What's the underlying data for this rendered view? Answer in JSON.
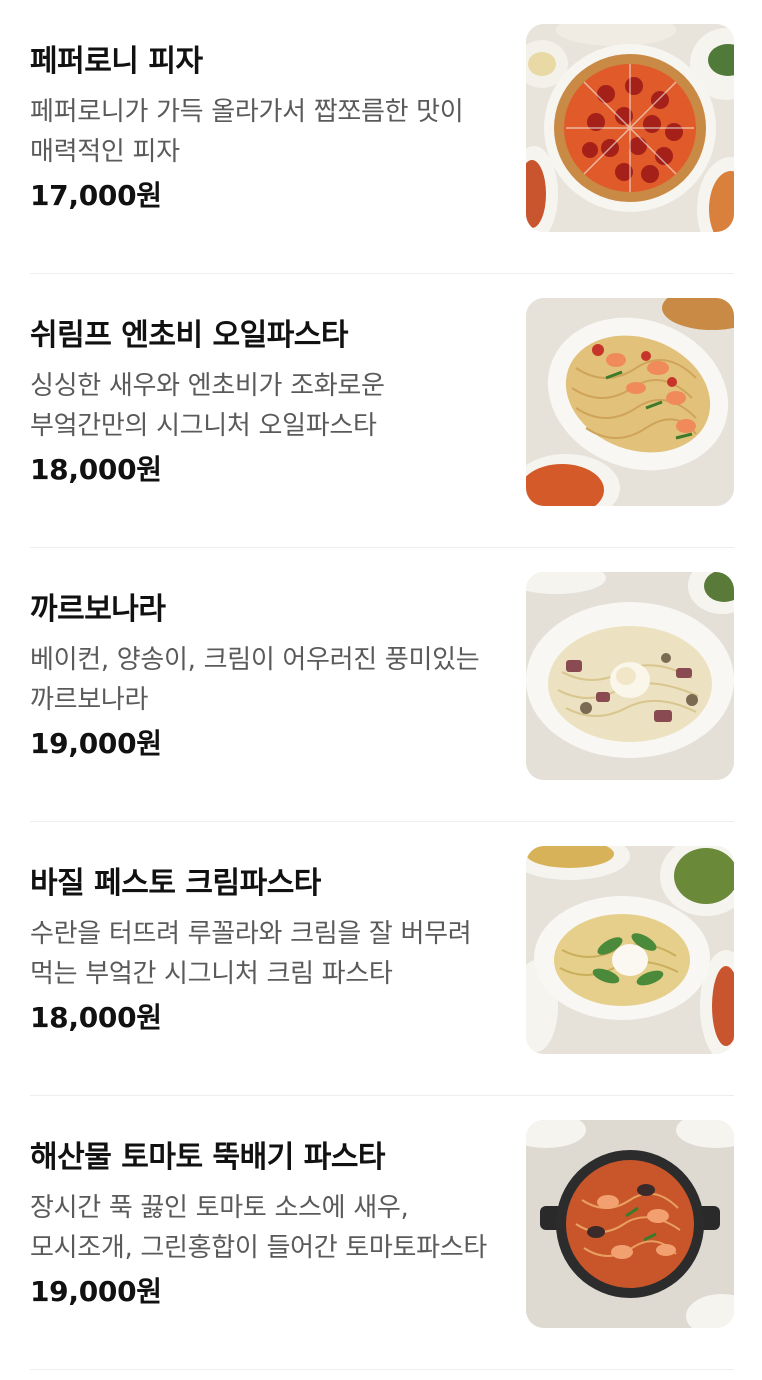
{
  "menu": {
    "items": [
      {
        "name": "페퍼로니 피자",
        "description": "페퍼로니가 가득 올라가서 짭쪼름한 맛이 매력적인 피자",
        "price": "17,000원",
        "image_icon": "pepperoni-pizza-photo"
      },
      {
        "name": "쉬림프 엔초비 오일파스타",
        "description": "싱싱한 새우와 엔초비가 조화로운 부엌간만의 시그니처 오일파스타",
        "price": "18,000원",
        "image_icon": "shrimp-anchovy-oil-pasta-photo"
      },
      {
        "name": "까르보나라",
        "description": "베이컨, 양송이, 크림이 어우러진 풍미있는 까르보나라",
        "price": "19,000원",
        "image_icon": "carbonara-photo"
      },
      {
        "name": "바질 페스토 크림파스타",
        "description": "수란을 터뜨려 루꼴라와 크림을 잘 버무려 먹는 부엌간 시그니처 크림 파스타",
        "price": "18,000원",
        "image_icon": "basil-pesto-cream-pasta-photo"
      },
      {
        "name": "해산물 토마토 뚝배기 파스타",
        "description": "장시간 푹 끓인 토마토 소스에 새우, 모시조개, 그린홍합이 들어간 토마토파스타",
        "price": "19,000원",
        "image_icon": "seafood-tomato-pasta-photo"
      }
    ]
  },
  "colors": {
    "background": "#ffffff",
    "title": "#111111",
    "description": "#5a5a5a",
    "divider": "#eeeeee"
  }
}
